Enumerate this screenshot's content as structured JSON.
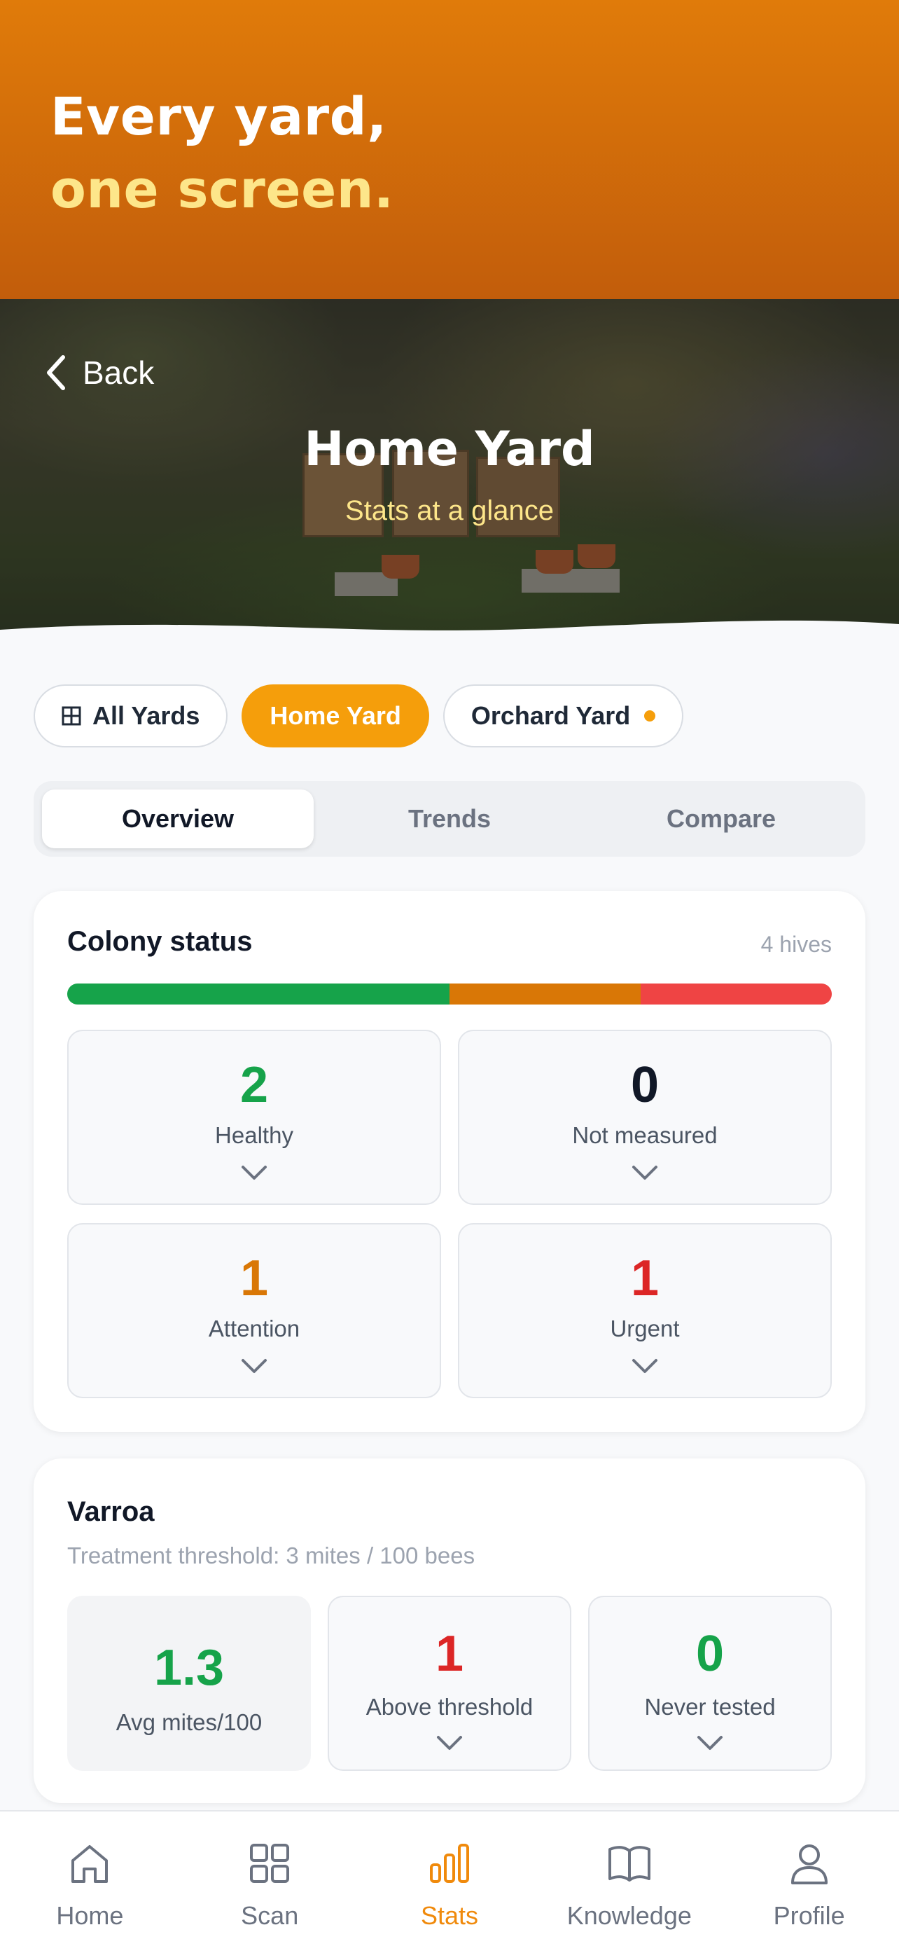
{
  "promo": {
    "line1": "Every yard,",
    "line2": "one screen."
  },
  "hero": {
    "back_label": "Back",
    "title": "Home Yard",
    "subtitle": "Stats at a glance"
  },
  "yard_chips": [
    {
      "label": "All Yards",
      "icon": "grid-icon",
      "active": false
    },
    {
      "label": "Home Yard",
      "active": true
    },
    {
      "label": "Orchard Yard",
      "has_dot": true,
      "active": false
    }
  ],
  "tabs": [
    {
      "label": "Overview",
      "active": true
    },
    {
      "label": "Trends",
      "active": false
    },
    {
      "label": "Compare",
      "active": false
    }
  ],
  "colony_status": {
    "title": "Colony status",
    "hive_count": "4 hives",
    "bar_segments": [
      {
        "name": "healthy",
        "fraction": 0.5,
        "color": "#16a34a"
      },
      {
        "name": "attention",
        "fraction": 0.25,
        "color": "#d97706"
      },
      {
        "name": "urgent",
        "fraction": 0.25,
        "color": "#ef4444"
      }
    ],
    "tiles": [
      {
        "value": "2",
        "label": "Healthy",
        "color": "#16a34a"
      },
      {
        "value": "0",
        "label": "Not measured",
        "color": "#111827"
      },
      {
        "value": "1",
        "label": "Attention",
        "color": "#d97706"
      },
      {
        "value": "1",
        "label": "Urgent",
        "color": "#dc2626"
      }
    ]
  },
  "varroa": {
    "title": "Varroa",
    "subtitle": "Treatment threshold: 3 mites / 100 bees",
    "tiles": [
      {
        "value": "1.3",
        "label": "Avg mites/100",
        "color": "#16a34a"
      },
      {
        "value": "1",
        "label": "Above threshold",
        "color": "#dc2626"
      },
      {
        "value": "0",
        "label": "Never tested",
        "color": "#16a34a"
      }
    ]
  },
  "bottom_nav": [
    {
      "label": "Home",
      "icon": "home-icon",
      "active": false
    },
    {
      "label": "Scan",
      "icon": "grid-icon",
      "active": false
    },
    {
      "label": "Stats",
      "icon": "bar-chart-icon",
      "active": true
    },
    {
      "label": "Knowledge",
      "icon": "book-icon",
      "active": false
    },
    {
      "label": "Profile",
      "icon": "user-icon",
      "active": false
    }
  ]
}
